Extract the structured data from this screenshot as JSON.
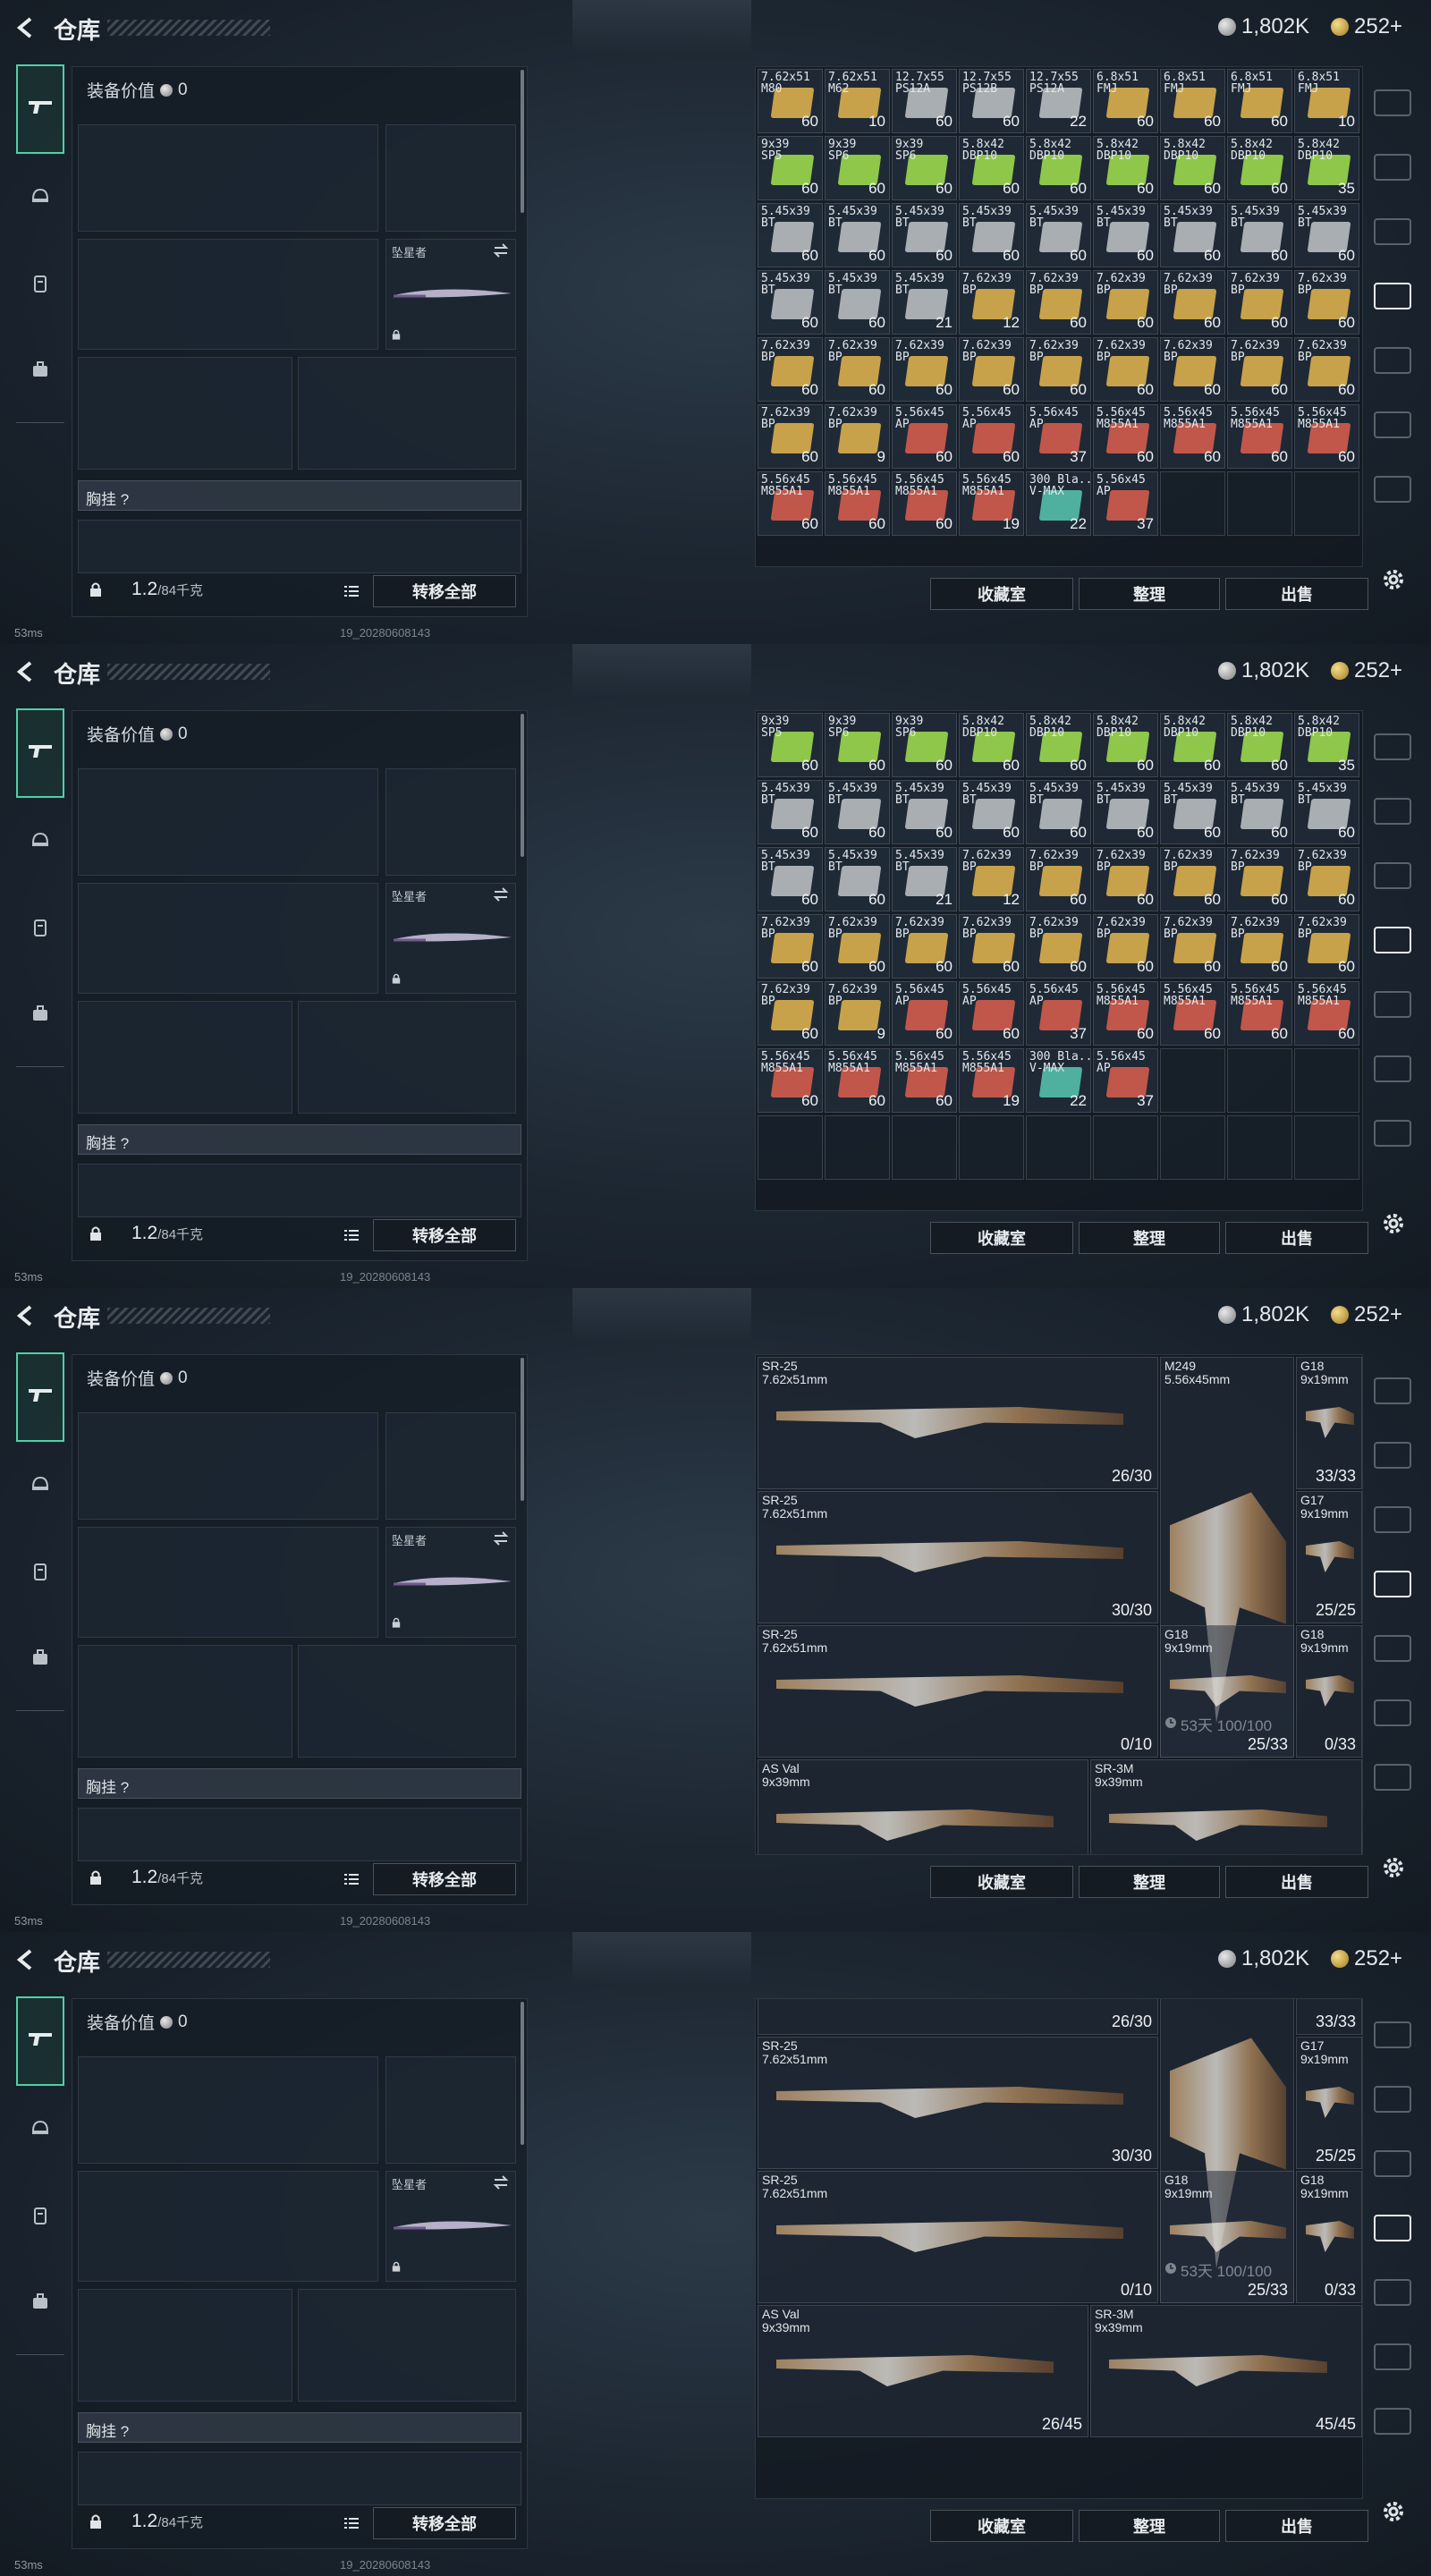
{
  "screen": {
    "title": "仓库",
    "currency_silver": "1,802K",
    "currency_gold": "252+",
    "equip_value_label": "装备价值",
    "equip_value": "0",
    "knife_label": "坠星者",
    "chest_label": "胸挂",
    "chest_help": "?",
    "weight_current": "1.2",
    "weight_max": "/84千克",
    "transfer_all": "转移全部",
    "btn_favorites": "收藏室",
    "btn_sort": "整理",
    "btn_sell": "出售",
    "ping": "53ms",
    "build": "19_20280608143"
  },
  "colors": {
    "accent": "#4fd1a6",
    "ammo_gold": "#c8a24a",
    "ammo_green": "#8fc74a",
    "ammo_grey": "#a9aeb2",
    "ammo_red": "#c0574a",
    "ammo_teal": "#4fb0a0"
  },
  "ammo_grid_1": [
    {
      "n": "7.62x51\nM80",
      "c": "60",
      "k": "ammo_gold"
    },
    {
      "n": "7.62x51\nM62",
      "c": "10",
      "k": "ammo_gold"
    },
    {
      "n": "12.7x55\nPS12A",
      "c": "60",
      "k": "ammo_grey"
    },
    {
      "n": "12.7x55\nPS12B",
      "c": "60",
      "k": "ammo_grey"
    },
    {
      "n": "12.7x55\nPS12A",
      "c": "22",
      "k": "ammo_grey"
    },
    {
      "n": "6.8x51\nFMJ",
      "c": "60",
      "k": "ammo_gold"
    },
    {
      "n": "6.8x51\nFMJ",
      "c": "60",
      "k": "ammo_gold"
    },
    {
      "n": "6.8x51\nFMJ",
      "c": "60",
      "k": "ammo_gold"
    },
    {
      "n": "6.8x51\nFMJ",
      "c": "10",
      "k": "ammo_gold"
    },
    {
      "n": "9x39\nSP5",
      "c": "60",
      "k": "ammo_green"
    },
    {
      "n": "9x39\nSP6",
      "c": "60",
      "k": "ammo_green"
    },
    {
      "n": "9x39\nSP6",
      "c": "60",
      "k": "ammo_green"
    },
    {
      "n": "5.8x42\nDBP10",
      "c": "60",
      "k": "ammo_green"
    },
    {
      "n": "5.8x42\nDBP10",
      "c": "60",
      "k": "ammo_green"
    },
    {
      "n": "5.8x42\nDBP10",
      "c": "60",
      "k": "ammo_green"
    },
    {
      "n": "5.8x42\nDBP10",
      "c": "60",
      "k": "ammo_green"
    },
    {
      "n": "5.8x42\nDBP10",
      "c": "60",
      "k": "ammo_green"
    },
    {
      "n": "5.8x42\nDBP10",
      "c": "35",
      "k": "ammo_green"
    },
    {
      "n": "5.45x39\nBT",
      "c": "60",
      "k": "ammo_grey"
    },
    {
      "n": "5.45x39\nBT",
      "c": "60",
      "k": "ammo_grey"
    },
    {
      "n": "5.45x39\nBT",
      "c": "60",
      "k": "ammo_grey"
    },
    {
      "n": "5.45x39\nBT",
      "c": "60",
      "k": "ammo_grey"
    },
    {
      "n": "5.45x39\nBT",
      "c": "60",
      "k": "ammo_grey"
    },
    {
      "n": "5.45x39\nBT",
      "c": "60",
      "k": "ammo_grey"
    },
    {
      "n": "5.45x39\nBT",
      "c": "60",
      "k": "ammo_grey"
    },
    {
      "n": "5.45x39\nBT",
      "c": "60",
      "k": "ammo_grey"
    },
    {
      "n": "5.45x39\nBT",
      "c": "60",
      "k": "ammo_grey"
    },
    {
      "n": "5.45x39\nBT",
      "c": "60",
      "k": "ammo_grey"
    },
    {
      "n": "5.45x39\nBT",
      "c": "60",
      "k": "ammo_grey"
    },
    {
      "n": "5.45x39\nBT",
      "c": "21",
      "k": "ammo_grey"
    },
    {
      "n": "7.62x39\nBP",
      "c": "12",
      "k": "ammo_gold"
    },
    {
      "n": "7.62x39\nBP",
      "c": "60",
      "k": "ammo_gold"
    },
    {
      "n": "7.62x39\nBP",
      "c": "60",
      "k": "ammo_gold"
    },
    {
      "n": "7.62x39\nBP",
      "c": "60",
      "k": "ammo_gold"
    },
    {
      "n": "7.62x39\nBP",
      "c": "60",
      "k": "ammo_gold"
    },
    {
      "n": "7.62x39\nBP",
      "c": "60",
      "k": "ammo_gold"
    },
    {
      "n": "7.62x39\nBP",
      "c": "60",
      "k": "ammo_gold"
    },
    {
      "n": "7.62x39\nBP",
      "c": "60",
      "k": "ammo_gold"
    },
    {
      "n": "7.62x39\nBP",
      "c": "60",
      "k": "ammo_gold"
    },
    {
      "n": "7.62x39\nBP",
      "c": "60",
      "k": "ammo_gold"
    },
    {
      "n": "7.62x39\nBP",
      "c": "60",
      "k": "ammo_gold"
    },
    {
      "n": "7.62x39\nBP",
      "c": "60",
      "k": "ammo_gold"
    },
    {
      "n": "7.62x39\nBP",
      "c": "60",
      "k": "ammo_gold"
    },
    {
      "n": "7.62x39\nBP",
      "c": "60",
      "k": "ammo_gold"
    },
    {
      "n": "7.62x39\nBP",
      "c": "60",
      "k": "ammo_gold"
    },
    {
      "n": "7.62x39\nBP",
      "c": "60",
      "k": "ammo_gold"
    },
    {
      "n": "7.62x39\nBP",
      "c": "9",
      "k": "ammo_gold"
    },
    {
      "n": "5.56x45\nAP",
      "c": "60",
      "k": "ammo_red"
    },
    {
      "n": "5.56x45\nAP",
      "c": "60",
      "k": "ammo_red"
    },
    {
      "n": "5.56x45\nAP",
      "c": "37",
      "k": "ammo_red"
    },
    {
      "n": "5.56x45\nM855A1",
      "c": "60",
      "k": "ammo_red"
    },
    {
      "n": "5.56x45\nM855A1",
      "c": "60",
      "k": "ammo_red"
    },
    {
      "n": "5.56x45\nM855A1",
      "c": "60",
      "k": "ammo_red"
    },
    {
      "n": "5.56x45\nM855A1",
      "c": "60",
      "k": "ammo_red"
    },
    {
      "n": "5.56x45\nM855A1",
      "c": "60",
      "k": "ammo_red"
    },
    {
      "n": "5.56x45\nM855A1",
      "c": "60",
      "k": "ammo_red"
    },
    {
      "n": "5.56x45\nM855A1",
      "c": "60",
      "k": "ammo_red"
    },
    {
      "n": "5.56x45\nM855A1",
      "c": "19",
      "k": "ammo_red"
    },
    {
      "n": "300 Bla..\nV-MAX",
      "c": "22",
      "k": "ammo_teal"
    },
    {
      "n": "5.56x45\nAP",
      "c": "37",
      "k": "ammo_red"
    }
  ],
  "ammo_grid_2": [
    {
      "n": "9x39\nSP5",
      "c": "60",
      "k": "ammo_green"
    },
    {
      "n": "9x39\nSP6",
      "c": "60",
      "k": "ammo_green"
    },
    {
      "n": "9x39\nSP6",
      "c": "60",
      "k": "ammo_green"
    },
    {
      "n": "5.8x42\nDBP10",
      "c": "60",
      "k": "ammo_green"
    },
    {
      "n": "5.8x42\nDBP10",
      "c": "60",
      "k": "ammo_green"
    },
    {
      "n": "5.8x42\nDBP10",
      "c": "60",
      "k": "ammo_green"
    },
    {
      "n": "5.8x42\nDBP10",
      "c": "60",
      "k": "ammo_green"
    },
    {
      "n": "5.8x42\nDBP10",
      "c": "60",
      "k": "ammo_green"
    },
    {
      "n": "5.8x42\nDBP10",
      "c": "35",
      "k": "ammo_green"
    },
    {
      "n": "5.45x39\nBT",
      "c": "60",
      "k": "ammo_grey"
    },
    {
      "n": "5.45x39\nBT",
      "c": "60",
      "k": "ammo_grey"
    },
    {
      "n": "5.45x39\nBT",
      "c": "60",
      "k": "ammo_grey"
    },
    {
      "n": "5.45x39\nBT",
      "c": "60",
      "k": "ammo_grey"
    },
    {
      "n": "5.45x39\nBT",
      "c": "60",
      "k": "ammo_grey"
    },
    {
      "n": "5.45x39\nBT",
      "c": "60",
      "k": "ammo_grey"
    },
    {
      "n": "5.45x39\nBT",
      "c": "60",
      "k": "ammo_grey"
    },
    {
      "n": "5.45x39\nBT",
      "c": "60",
      "k": "ammo_grey"
    },
    {
      "n": "5.45x39\nBT",
      "c": "60",
      "k": "ammo_grey"
    },
    {
      "n": "5.45x39\nBT",
      "c": "60",
      "k": "ammo_grey"
    },
    {
      "n": "5.45x39\nBT",
      "c": "60",
      "k": "ammo_grey"
    },
    {
      "n": "5.45x39\nBT",
      "c": "21",
      "k": "ammo_grey"
    },
    {
      "n": "7.62x39\nBP",
      "c": "12",
      "k": "ammo_gold"
    },
    {
      "n": "7.62x39\nBP",
      "c": "60",
      "k": "ammo_gold"
    },
    {
      "n": "7.62x39\nBP",
      "c": "60",
      "k": "ammo_gold"
    },
    {
      "n": "7.62x39\nBP",
      "c": "60",
      "k": "ammo_gold"
    },
    {
      "n": "7.62x39\nBP",
      "c": "60",
      "k": "ammo_gold"
    },
    {
      "n": "7.62x39\nBP",
      "c": "60",
      "k": "ammo_gold"
    },
    {
      "n": "7.62x39\nBP",
      "c": "60",
      "k": "ammo_gold"
    },
    {
      "n": "7.62x39\nBP",
      "c": "60",
      "k": "ammo_gold"
    },
    {
      "n": "7.62x39\nBP",
      "c": "60",
      "k": "ammo_gold"
    },
    {
      "n": "7.62x39\nBP",
      "c": "60",
      "k": "ammo_gold"
    },
    {
      "n": "7.62x39\nBP",
      "c": "60",
      "k": "ammo_gold"
    },
    {
      "n": "7.62x39\nBP",
      "c": "60",
      "k": "ammo_gold"
    },
    {
      "n": "7.62x39\nBP",
      "c": "60",
      "k": "ammo_gold"
    },
    {
      "n": "7.62x39\nBP",
      "c": "60",
      "k": "ammo_gold"
    },
    {
      "n": "7.62x39\nBP",
      "c": "60",
      "k": "ammo_gold"
    },
    {
      "n": "7.62x39\nBP",
      "c": "60",
      "k": "ammo_gold"
    },
    {
      "n": "7.62x39\nBP",
      "c": "9",
      "k": "ammo_gold"
    },
    {
      "n": "5.56x45\nAP",
      "c": "60",
      "k": "ammo_red"
    },
    {
      "n": "5.56x45\nAP",
      "c": "60",
      "k": "ammo_red"
    },
    {
      "n": "5.56x45\nAP",
      "c": "37",
      "k": "ammo_red"
    },
    {
      "n": "5.56x45\nM855A1",
      "c": "60",
      "k": "ammo_red"
    },
    {
      "n": "5.56x45\nM855A1",
      "c": "60",
      "k": "ammo_red"
    },
    {
      "n": "5.56x45\nM855A1",
      "c": "60",
      "k": "ammo_red"
    },
    {
      "n": "5.56x45\nM855A1",
      "c": "60",
      "k": "ammo_red"
    },
    {
      "n": "5.56x45\nM855A1",
      "c": "60",
      "k": "ammo_red"
    },
    {
      "n": "5.56x45\nM855A1",
      "c": "60",
      "k": "ammo_red"
    },
    {
      "n": "5.56x45\nM855A1",
      "c": "60",
      "k": "ammo_red"
    },
    {
      "n": "5.56x45\nM855A1",
      "c": "19",
      "k": "ammo_red"
    },
    {
      "n": "300 Bla..\nV-MAX",
      "c": "22",
      "k": "ammo_teal"
    },
    {
      "n": "5.56x45\nAP",
      "c": "37",
      "k": "ammo_red"
    }
  ],
  "weapons_3": [
    {
      "n": "SR-25\n7.62x51mm",
      "a": "26/30"
    },
    {
      "n": "SR-25\n7.62x51mm",
      "a": "30/30"
    },
    {
      "n": "SR-25\n7.62x51mm",
      "a": "0/10"
    },
    {
      "n": "M249\n5.56x45mm",
      "a": "",
      "ex": "53天 100/100"
    },
    {
      "n": "G18\n9x19mm",
      "a": "25/33"
    },
    {
      "n": "G18\n9x19mm",
      "a": "33/33"
    },
    {
      "n": "G17\n9x19mm",
      "a": "25/25"
    },
    {
      "n": "G18\n9x19mm",
      "a": "0/33"
    },
    {
      "n": "AS Val\n9x39mm",
      "a": ""
    },
    {
      "n": "SR-3M\n9x39mm",
      "a": ""
    }
  ],
  "weapons_4": [
    {
      "n": "",
      "a": "26/30"
    },
    {
      "n": "SR-25\n7.62x51mm",
      "a": "30/30"
    },
    {
      "n": "SR-25\n7.62x51mm",
      "a": "0/10"
    },
    {
      "n": "",
      "a": "",
      "ex": "53天 100/100"
    },
    {
      "n": "G18\n9x19mm",
      "a": "25/33"
    },
    {
      "n": "",
      "a": "33/33"
    },
    {
      "n": "G17\n9x19mm",
      "a": "25/25"
    },
    {
      "n": "G18\n9x19mm",
      "a": "0/33"
    },
    {
      "n": "AS Val\n9x39mm",
      "a": "26/45"
    },
    {
      "n": "SR-3M\n9x39mm",
      "a": "45/45"
    }
  ]
}
